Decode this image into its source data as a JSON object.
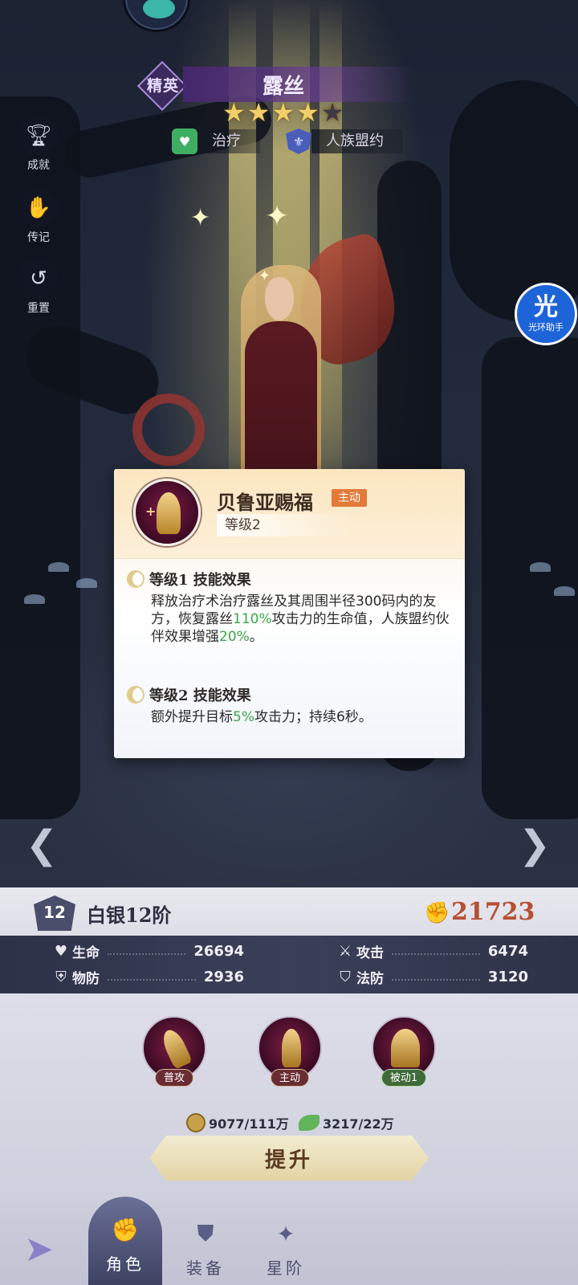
{
  "hero": {
    "rank": "精英",
    "name": "露丝",
    "stars_filled": 4,
    "stars_total": 5,
    "tags": [
      {
        "icon": "heal-icon",
        "label": "治疗",
        "color": "#3fae63"
      },
      {
        "icon": "alliance-icon",
        "label": "人族盟约",
        "color": "#4a5db8"
      }
    ]
  },
  "side_menu": [
    {
      "icon": "trophy-icon",
      "label": "成就"
    },
    {
      "icon": "handshake-icon",
      "label": "传记"
    },
    {
      "icon": "reset-icon",
      "label": "重置"
    }
  ],
  "helper": {
    "glyph": "光",
    "label": "光环助手"
  },
  "skill_popup": {
    "name": "贝鲁亚赐福",
    "type_tag": "主动",
    "level": "等级2",
    "effects": [
      {
        "title": "等级1 技能效果",
        "parts": [
          {
            "text": "释放治疗术治疗露丝及其周围半径300码内的友方，恢复露丝",
            "highlight": false
          },
          {
            "text": "110%",
            "highlight": true
          },
          {
            "text": "攻击力的生命值，人族盟约伙伴效果增强",
            "highlight": false
          },
          {
            "text": "20%",
            "highlight": true
          },
          {
            "text": "。",
            "highlight": false
          }
        ]
      },
      {
        "title": "等级2 技能效果",
        "parts": [
          {
            "text": "额外提升目标",
            "highlight": false
          },
          {
            "text": "5%",
            "highlight": true
          },
          {
            "text": "攻击力；持续6秒。",
            "highlight": false
          }
        ]
      }
    ]
  },
  "panel": {
    "level_number": "12",
    "tier": "白银12阶",
    "power": "21723",
    "stats": {
      "hp": {
        "icon": "heart-icon",
        "label": "生命",
        "value": "26694"
      },
      "attack": {
        "icon": "sword-icon",
        "label": "攻击",
        "value": "6474"
      },
      "phys_def": {
        "icon": "shield-icon",
        "label": "物防",
        "value": "2936"
      },
      "magic_def": {
        "icon": "magic-shield-icon",
        "label": "法防",
        "value": "3120"
      }
    },
    "skills": [
      {
        "label": "普攻",
        "badge_color": "#6a2c33"
      },
      {
        "label": "主动",
        "badge_color": "#6a2c33"
      },
      {
        "label": "被动1",
        "badge_color": "#3f6a3a"
      }
    ],
    "resources": {
      "gold": "9077/111万",
      "exp": "3217/22万"
    },
    "upgrade_label": "提升"
  },
  "bottom_nav": {
    "tabs": [
      {
        "label": "角色",
        "icon": "fist-icon",
        "active": true
      },
      {
        "label": "装备",
        "icon": "armor-icon",
        "active": false
      },
      {
        "label": "星阶",
        "icon": "star-compass-icon",
        "active": false
      }
    ]
  }
}
